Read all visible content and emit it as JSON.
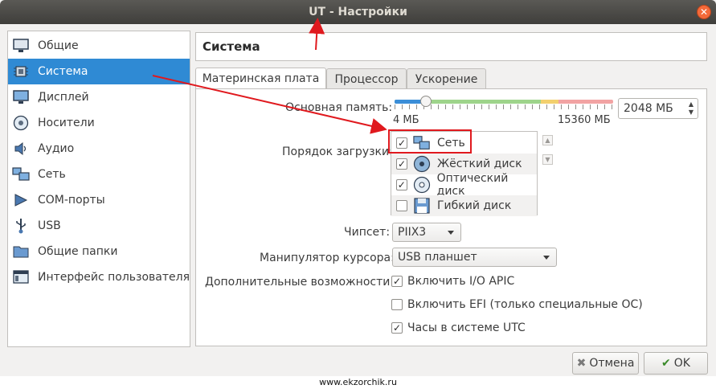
{
  "window": {
    "title": "UT - Настройки",
    "close_glyph": "✕"
  },
  "sidebar": {
    "items": [
      {
        "label": "Общие",
        "icon": "monitor-icon"
      },
      {
        "label": "Система",
        "icon": "chip-icon",
        "selected": true
      },
      {
        "label": "Дисплей",
        "icon": "display-icon"
      },
      {
        "label": "Носители",
        "icon": "disc-icon"
      },
      {
        "label": "Аудио",
        "icon": "speaker-icon"
      },
      {
        "label": "Сеть",
        "icon": "network-icon"
      },
      {
        "label": "COM-порты",
        "icon": "serial-port-icon"
      },
      {
        "label": "USB",
        "icon": "usb-icon"
      },
      {
        "label": "Общие папки",
        "icon": "folder-icon"
      },
      {
        "label": "Интерфейс пользователя",
        "icon": "ui-icon"
      }
    ]
  },
  "header": {
    "title": "Система"
  },
  "tabs": [
    {
      "label": "Материнская плата",
      "active": true
    },
    {
      "label": "Процессор"
    },
    {
      "label": "Ускорение"
    }
  ],
  "motherboard": {
    "memory": {
      "label": "Основная память:",
      "min_label": "4 МБ",
      "max_label": "15360 МБ",
      "value": "2048 МБ",
      "level_fraction": 0.133
    },
    "boot_order": {
      "label": "Порядок загрузки:",
      "items": [
        {
          "label": "Сеть",
          "checked": true,
          "icon": "network-icon"
        },
        {
          "label": "Жёсткий диск",
          "checked": true,
          "icon": "hard-disk-icon"
        },
        {
          "label": "Оптический диск",
          "checked": true,
          "icon": "optical-disk-icon"
        },
        {
          "label": "Гибкий диск",
          "checked": false,
          "icon": "floppy-disk-icon"
        }
      ]
    },
    "chipset": {
      "label": "Чипсет:",
      "value": "PIIX3"
    },
    "pointing": {
      "label": "Манипулятор курсора:",
      "value": "USB планшет"
    },
    "extended": {
      "label": "Дополнительные возможности:",
      "options": [
        {
          "label": "Включить I/O APIC",
          "checked": true
        },
        {
          "label": "Включить EFI (только специальные ОС)",
          "checked": false
        },
        {
          "label": "Часы в системе UTC",
          "checked": true
        }
      ]
    }
  },
  "buttons": {
    "cancel": "Отмена",
    "ok": "OK"
  },
  "watermark": "www.ekzorchik.ru",
  "colors": {
    "selection": "#2f8ad4",
    "annotation": "#e0191e",
    "window_bg": "#f2f1f0"
  }
}
